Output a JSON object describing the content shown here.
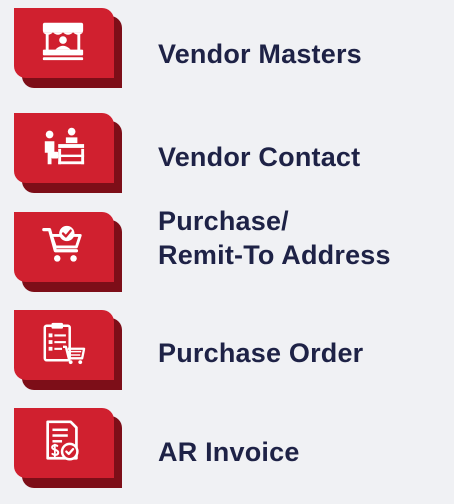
{
  "menu": {
    "items": [
      {
        "id": "vendor-masters",
        "icon": "vendor-stall-icon",
        "lines": [
          "Vendor Masters"
        ]
      },
      {
        "id": "vendor-contact",
        "icon": "vendor-contact-icon",
        "lines": [
          "Vendor Contact"
        ]
      },
      {
        "id": "purchase-remit-to-address",
        "icon": "cart-check-icon",
        "lines": [
          "Purchase/",
          "Remit-To Address"
        ]
      },
      {
        "id": "purchase-order",
        "icon": "clipboard-cart-icon",
        "lines": [
          "Purchase Order"
        ]
      },
      {
        "id": "ar-invoice",
        "icon": "invoice-dollar-icon",
        "lines": [
          "AR Invoice"
        ]
      }
    ]
  },
  "colors": {
    "tile": "#d0202f",
    "tile_shadow": "#7d0e18",
    "label": "#1e2246",
    "background": "#f0f1f4"
  }
}
